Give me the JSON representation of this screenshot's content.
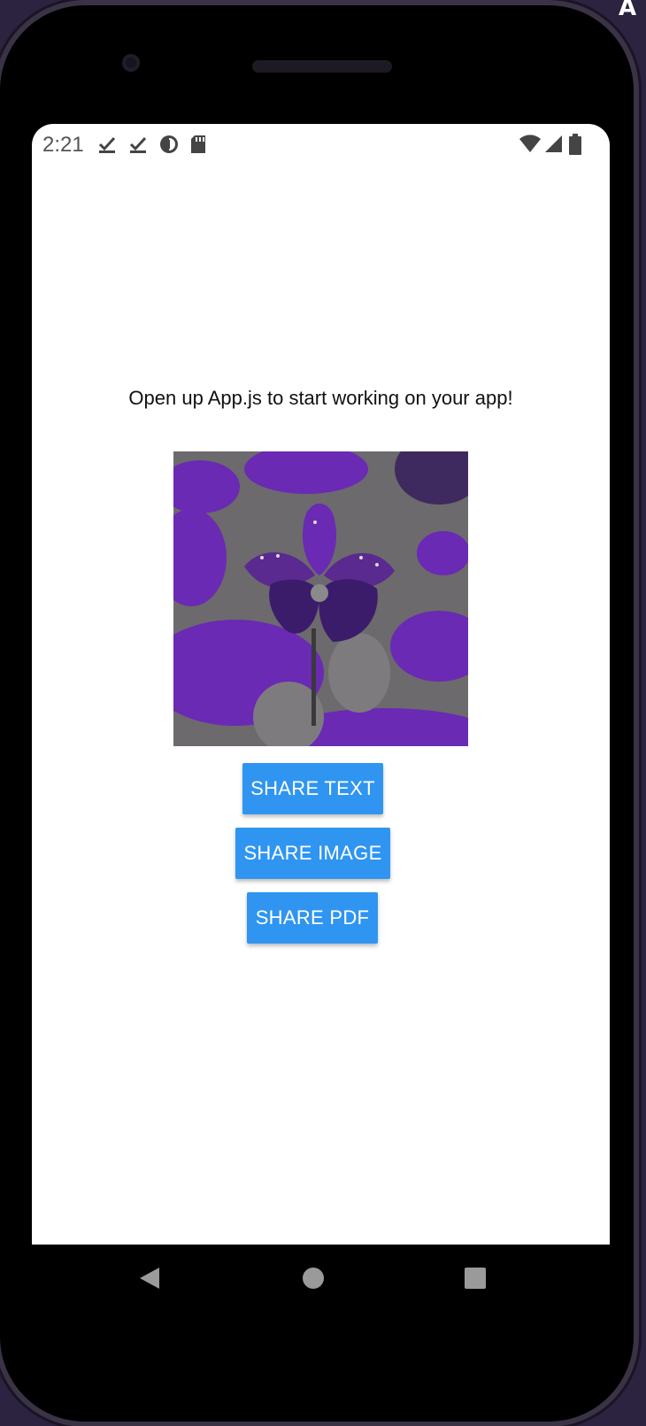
{
  "status_bar": {
    "time": "2:21",
    "left_icons": [
      "download-done-icon",
      "download-done-icon",
      "data-saver-icon",
      "sd-card-icon"
    ],
    "right_icons": [
      "wifi-icon",
      "cell-signal-icon",
      "battery-icon"
    ]
  },
  "app": {
    "message": "Open up App.js to start working on your app!",
    "image_description_icon": "iris-flower-image",
    "buttons": {
      "share_text": "SHARE TEXT",
      "share_image": "SHARE IMAGE",
      "share_pdf": "SHARE PDF"
    }
  },
  "nav_bar": {
    "icons": [
      "back-icon",
      "home-icon",
      "recents-icon"
    ]
  },
  "colors": {
    "button": "#2f95f0",
    "button_text": "#ffffff",
    "flower_purple": "#6a2ab4",
    "flower_gray": "#6c6a6c"
  }
}
